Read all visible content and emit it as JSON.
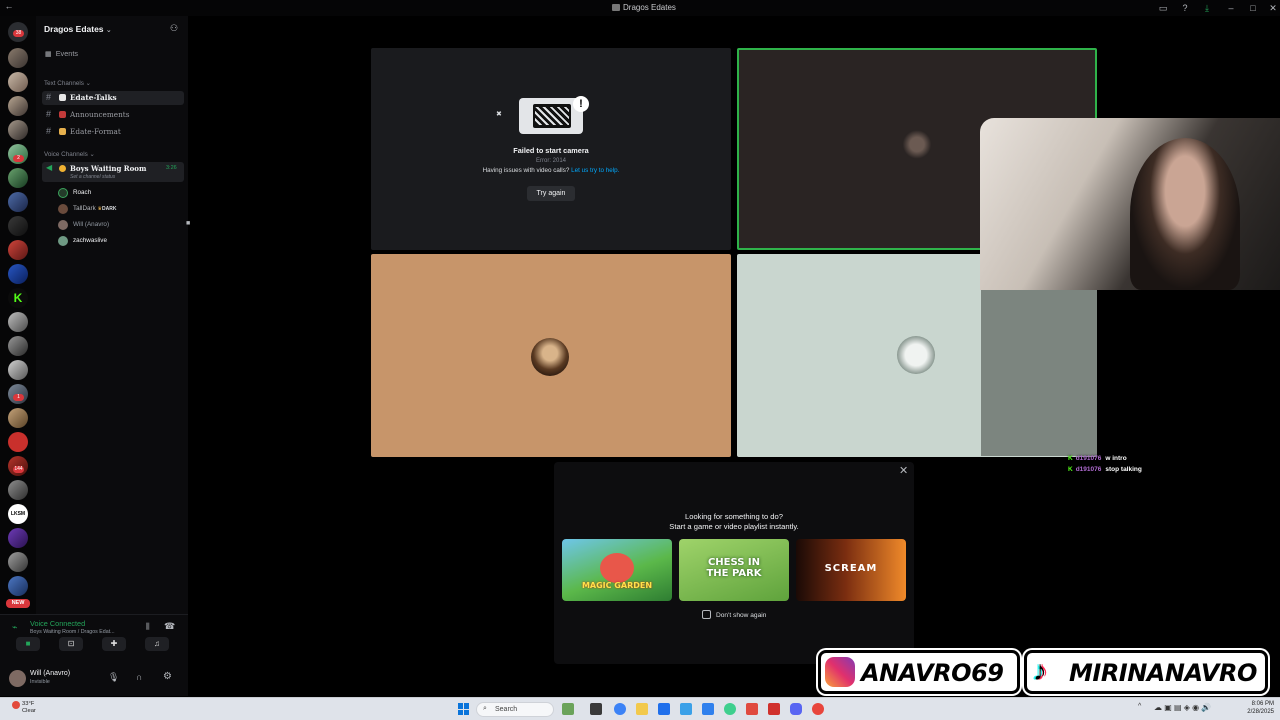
{
  "window": {
    "title": "Dragos Edates"
  },
  "server": {
    "name": "Dragos Edates"
  },
  "sidebar": {
    "events_label": "Events",
    "text_category": "Text Channels",
    "text_channels": [
      {
        "name": "Edate-Talks",
        "active": true
      },
      {
        "name": "Announcements",
        "active": false
      },
      {
        "name": "Edate-Format",
        "active": false
      }
    ],
    "voice_category": "Voice Channels",
    "voice_channel": {
      "name": "Boys Waiting Room",
      "status": "Set a channel status",
      "timer": "3:26"
    },
    "voice_users": [
      {
        "name": "Roach",
        "tag": ""
      },
      {
        "name": "TallDark",
        "tag": "DARK"
      },
      {
        "name": "Will (Anavro)",
        "tag": ""
      },
      {
        "name": "zachwaslive",
        "tag": ""
      }
    ]
  },
  "rail": {
    "new_badge": "NEW",
    "badges": [
      "38",
      "2",
      "1",
      "5",
      "73",
      "144",
      "4",
      "5"
    ]
  },
  "voice_panel": {
    "status": "Voice Connected",
    "location": "Boys Waiting Room / Dragos Edat..."
  },
  "user_panel": {
    "username": "Will (Anavro)",
    "status": "Invisible"
  },
  "camera_error": {
    "title": "Failed to start camera",
    "code": "Error: 2014",
    "help_prefix": "Having issues with video calls?",
    "help_link": "Let us try to help.",
    "retry": "Try again"
  },
  "activity": {
    "line1": "Looking for something to do?",
    "line2": "Start a game or video playlist instantly.",
    "games": [
      "MAGIC GARDEN",
      "CHESS IN THE PARK",
      "SCREAM"
    ],
    "dont_show": "Don't show again"
  },
  "chat": [
    {
      "user": "d191076",
      "message": "w intro"
    },
    {
      "user": "d191076",
      "message": "stop talking"
    }
  ],
  "socials": {
    "instagram": "ANAVRO69",
    "tiktok": "MIRINANAVRO"
  },
  "taskbar": {
    "search": "Search",
    "weather_temp": "33°F",
    "weather_desc": "Clear",
    "time": "8:06 PM",
    "date": "2/28/2025"
  },
  "colors": {
    "accent_green": "#2fb34a",
    "link_blue": "#00a8fc",
    "danger_red": "#da373c",
    "kick_green": "#53fc18"
  }
}
